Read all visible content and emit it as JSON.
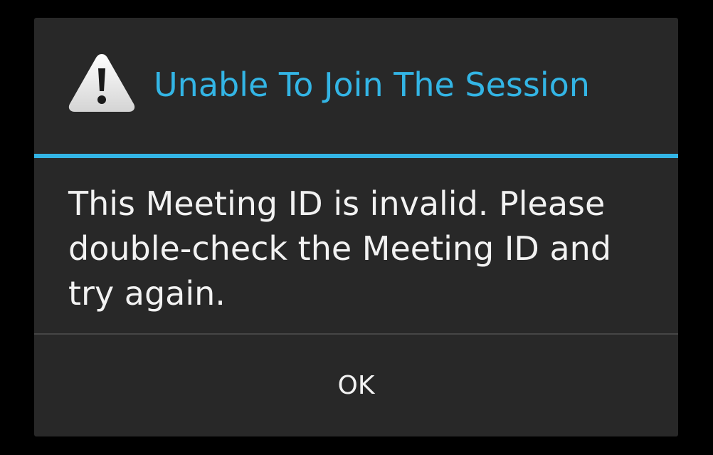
{
  "dialog": {
    "title": "Unable To Join The Session",
    "icon": "warning-icon",
    "message": "This Meeting ID is invalid. Please double-check the Meeting ID and try again.",
    "ok_label": "OK"
  },
  "colors": {
    "accent": "#33b5e5",
    "dialog_background": "#282828",
    "text": "#f2f2f2"
  }
}
